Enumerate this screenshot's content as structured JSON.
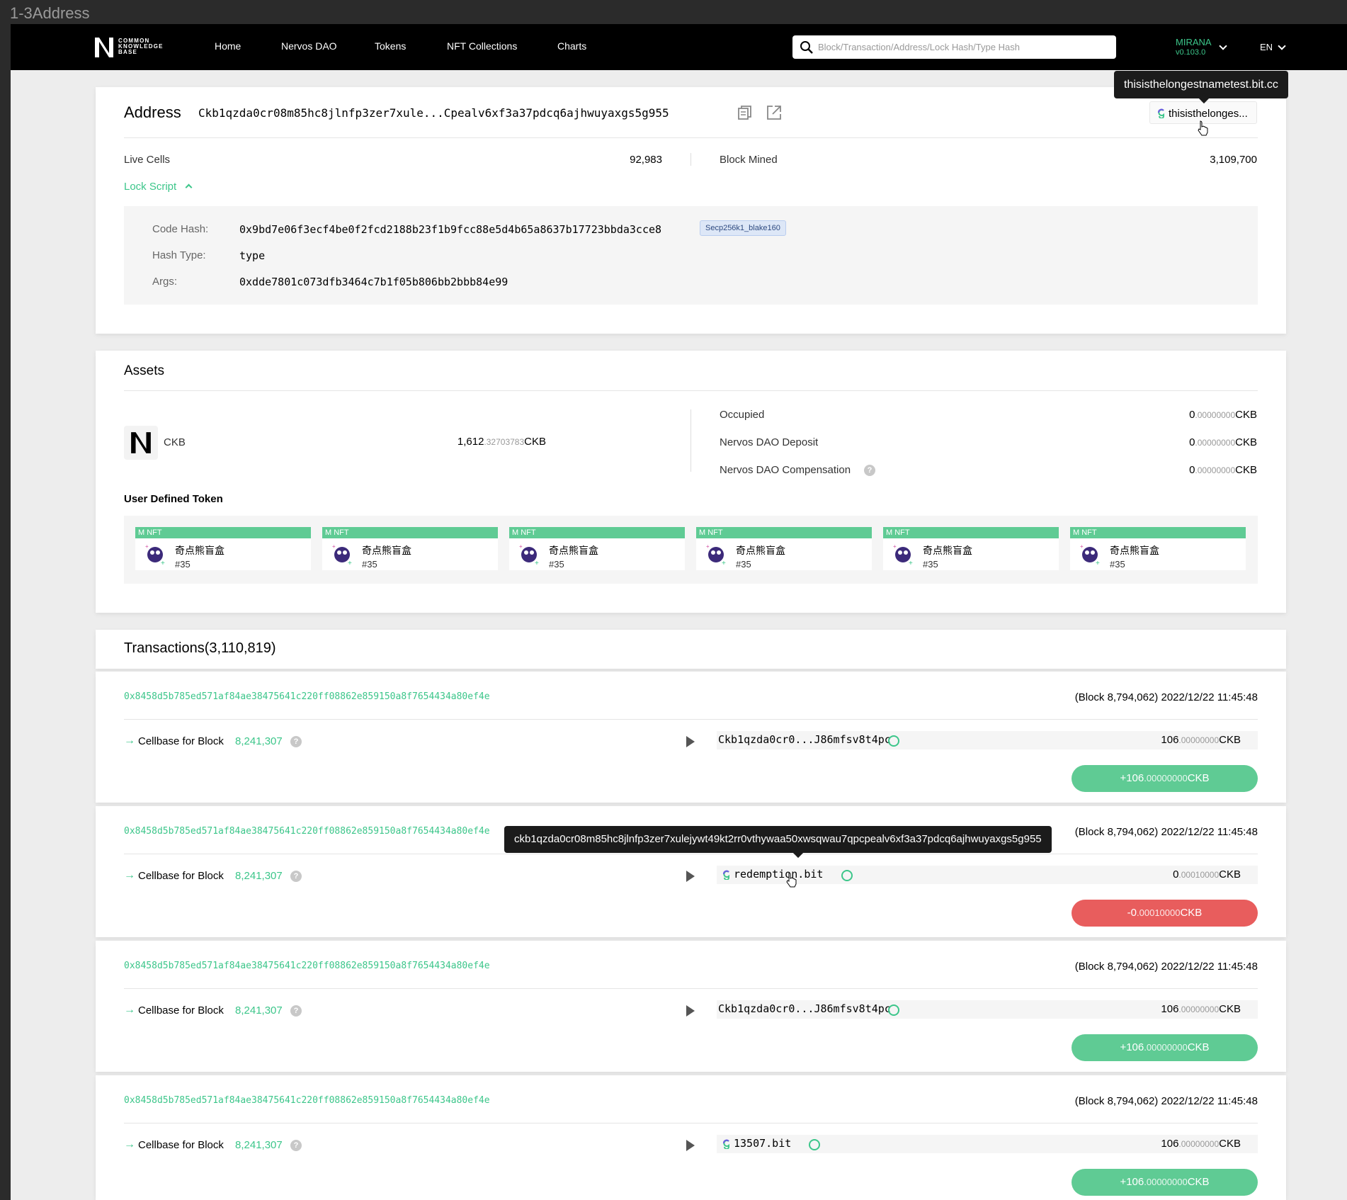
{
  "window": {
    "title": "1-3Address"
  },
  "nav": {
    "logo_lines": [
      "COMMON",
      "KNOWLEDGE",
      "BASE"
    ],
    "links": [
      "Home",
      "Nervos DAO",
      "Tokens",
      "NFT Collections",
      "Charts"
    ],
    "search_placeholder": "Block/Transaction/Address/Lock Hash/Type Hash",
    "network": "MIRANA",
    "version": "v0.103.0",
    "language": "EN"
  },
  "address": {
    "title": "Address",
    "hash": "Ckb1qzda0cr08m85hc8jlnfp3zer7xule...Cpealv6xf3a37pdcq6ajhwuyaxgs5g955",
    "bit_alias": "thisisthelonges...",
    "bit_tooltip": "thisisthelongestnametest.bit.cc",
    "live_cells_label": "Live Cells",
    "live_cells": "92,983",
    "block_mined_label": "Block Mined",
    "block_mined": "3,109,700",
    "lock_script_label": "Lock Script",
    "lock": {
      "code_hash_label": "Code Hash:",
      "code_hash": "0x9bd7e06f3ecf4be0f2fcd2188b23f1b9fcc88e5d4b65a8637b17723bbda3cce8",
      "code_hash_tag": "Secp256k1_blake160",
      "hash_type_label": "Hash Type:",
      "hash_type": "type",
      "args_label": "Args:",
      "args": "0xdde7801c073dfb3464c7b1f05b806bb2bbb84e99"
    }
  },
  "assets": {
    "title": "Assets",
    "ckb_name": "CKB",
    "ckb_int": "1,612",
    "ckb_dec": ".32703783",
    "unit": "CKB",
    "occupied_label": "Occupied",
    "occupied_int": "0",
    "occupied_dec": ".00000000",
    "dao_deposit_label": "Nervos DAO Deposit",
    "dao_deposit_int": "0",
    "dao_deposit_dec": ".00000000",
    "dao_comp_label": "Nervos DAO Compensation",
    "dao_comp_int": "0",
    "dao_comp_dec": ".00000000",
    "udt_title": "User Defined Token",
    "nfts": [
      {
        "tag": "M NFT",
        "name": "奇点熊盲盒",
        "id": "#35"
      },
      {
        "tag": "M NFT",
        "name": "奇点熊盲盒",
        "id": "#35"
      },
      {
        "tag": "M NFT",
        "name": "奇点熊盲盒",
        "id": "#35"
      },
      {
        "tag": "M NFT",
        "name": "奇点熊盲盒",
        "id": "#35"
      },
      {
        "tag": "M NFT",
        "name": "奇点熊盲盒",
        "id": "#35"
      },
      {
        "tag": "M NFT",
        "name": "奇点熊盲盒",
        "id": "#35"
      }
    ]
  },
  "transactions": {
    "title": "Transactions(3,110,819)",
    "items": [
      {
        "hash": "0x8458d5b785ed571af84ae38475641c220ff08862e859150a8f7654434a80ef4e",
        "block": "(Block 8,794,062) 2022/12/22 11:45:48",
        "arrow": "→",
        "cellbase": "Cellbase for Block",
        "cellbase_block": "8,241,307",
        "output": "Ckb1qzda0cr0...J86mfsv8t4pc",
        "output_bit": false,
        "amount_int": "106",
        "amount_dec": ".00000000",
        "change_int": "+106",
        "change_dec": ".00000000",
        "positive": true
      },
      {
        "hash": "0x8458d5b785ed571af84ae38475641c220ff08862e859150a8f7654434a80ef4e",
        "block": "(Block 8,794,062) 2022/12/22 11:45:48",
        "arrow": "→",
        "cellbase": "Cellbase for Block",
        "cellbase_block": "8,241,307",
        "output": "redemption.bit",
        "output_bit": true,
        "amount_int": "0",
        "amount_dec": ".00010000",
        "change_int": "-0",
        "change_dec": ".00010000",
        "positive": false
      },
      {
        "hash": "0x8458d5b785ed571af84ae38475641c220ff08862e859150a8f7654434a80ef4e",
        "block": "(Block 8,794,062) 2022/12/22 11:45:48",
        "arrow": "→",
        "cellbase": "Cellbase for Block",
        "cellbase_block": "8,241,307",
        "output": "Ckb1qzda0cr0...J86mfsv8t4pc",
        "output_bit": false,
        "amount_int": "106",
        "amount_dec": ".00000000",
        "change_int": "+106",
        "change_dec": ".00000000",
        "positive": true
      },
      {
        "hash": "0x8458d5b785ed571af84ae38475641c220ff08862e859150a8f7654434a80ef4e",
        "block": "(Block 8,794,062) 2022/12/22 11:45:48",
        "arrow": "→",
        "cellbase": "Cellbase for Block",
        "cellbase_block": "8,241,307",
        "output": "13507.bit",
        "output_bit": true,
        "amount_int": "106",
        "amount_dec": ".00000000",
        "change_int": "+106",
        "change_dec": ".00000000",
        "positive": true
      }
    ],
    "hover_tooltip": "ckb1qzda0cr08m85hc8jlnfp3zer7xulejywt49kt2rr0vthywaa50xwsqwau7qpcpealv6xf3a37pdcq6ajhwuyaxgs5g955"
  },
  "colors": {
    "accent": "#3cc68a",
    "negative": "#e85d5d",
    "nav_bg": "#000000"
  },
  "icons": [
    "search-icon",
    "copy-icon",
    "share-icon",
    "bit-logo-icon",
    "ckb-logo-icon",
    "help-icon",
    "play-icon",
    "pointer-cursor-icon"
  ]
}
